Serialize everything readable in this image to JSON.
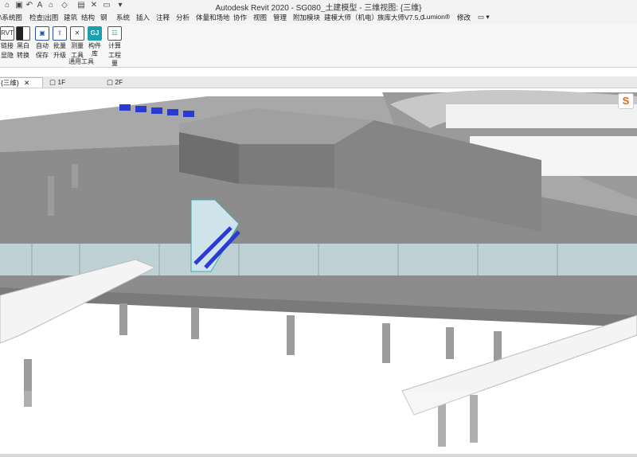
{
  "window": {
    "title": "Autodesk Revit 2020 - SG080_土建模型 - 三维视图: {三维}"
  },
  "quick_access": {
    "icons": [
      "open-icon",
      "save-icon",
      "undo-icon",
      "redo-icon",
      "print-icon",
      "measure-icon",
      "dimension-icon",
      "text-icon",
      "3d-view-icon",
      "section-icon",
      "switch-windows-icon",
      "close-inactive-icon",
      "customize-icon"
    ]
  },
  "menu": {
    "items": [
      "\\系统图",
      "检查|出图",
      "建筑",
      "结构",
      "钢",
      "系统",
      "插入",
      "注释",
      "分析",
      "体量和场地",
      "协作",
      "视图",
      "管理",
      "附加模块",
      "建模大师（机电）",
      "族库大师V7.5.0",
      "Lumion®",
      "修改"
    ]
  },
  "ribbon": {
    "buttons": [
      {
        "label1": "链接",
        "label2": "显隐",
        "icon": "link-icon"
      },
      {
        "label1": "黑白",
        "label2": "转换",
        "icon": "black-white-icon"
      },
      {
        "label1": "自动",
        "label2": "保存",
        "icon": "auto-save-icon"
      },
      {
        "label1": "批量",
        "label2": "升级",
        "icon": "batch-upgrade-icon"
      },
      {
        "label1": "测量",
        "label2": "工具",
        "icon": "measure-tool-icon"
      },
      {
        "label1": "构件库",
        "label2": "",
        "icon": "component-library-icon"
      },
      {
        "label1": "计算",
        "label2": "工程量",
        "icon": "quantity-icon"
      }
    ],
    "panel_label": "通用工具"
  },
  "view_tabs": [
    {
      "label": "{三维}",
      "active": true
    },
    {
      "label": "1F",
      "active": false
    },
    {
      "label": "2F",
      "active": false
    }
  ],
  "colors": {
    "model_gray": "#8f8f8f",
    "floor_gray": "#a3a3a3",
    "escalator_blue": "#2b3bd1",
    "glass": "#cfe3ea",
    "badge_orange": "#e8601c"
  },
  "viewport": {
    "content": "3D model view of station structure",
    "badge": "S"
  }
}
